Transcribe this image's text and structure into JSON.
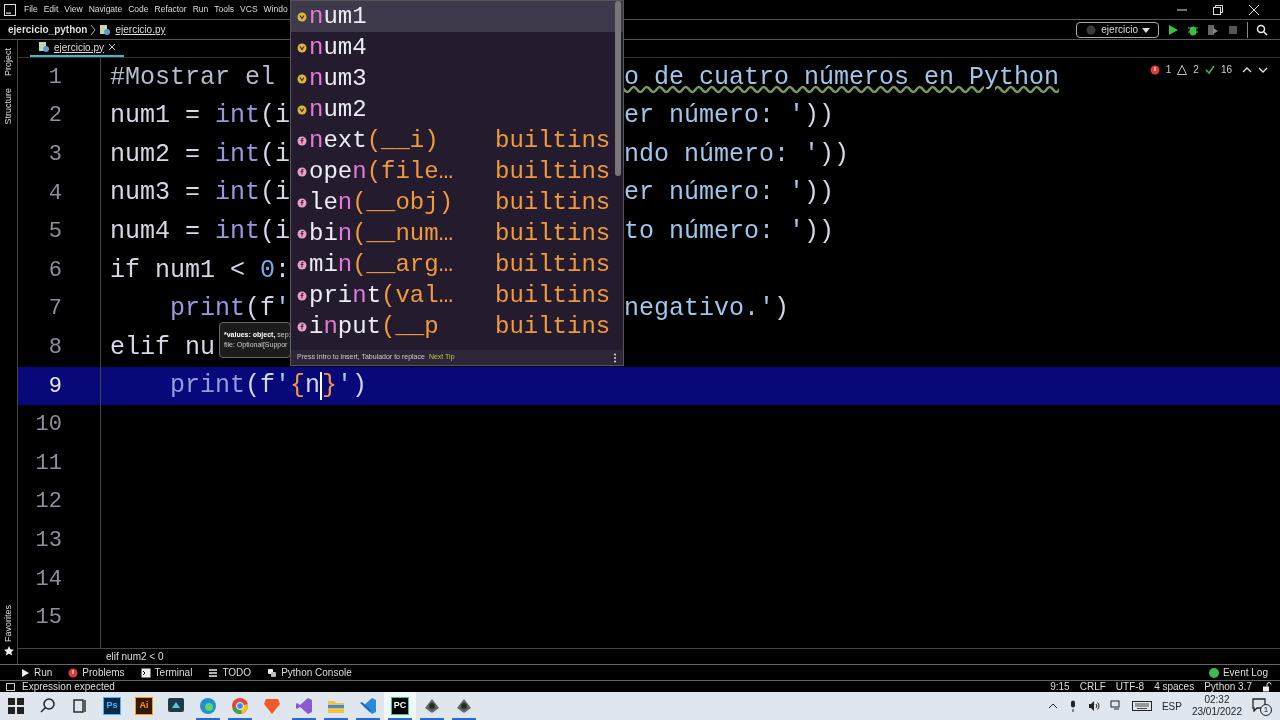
{
  "menu": [
    "File",
    "Edit",
    "View",
    "Navigate",
    "Code",
    "Refactor",
    "Run",
    "Tools",
    "VCS",
    "Windo"
  ],
  "breadcrumb": {
    "project": "ejercicio_python",
    "file": "ejercicio.py"
  },
  "run_config": "ejercicio",
  "tabs": [
    {
      "label": "ejercicio.py",
      "selected": true
    }
  ],
  "side_tools": [
    "Project",
    "Structure"
  ],
  "side_tools_bottom": [
    "Favorites"
  ],
  "inspections": [
    {
      "kind": "error",
      "count": "1"
    },
    {
      "kind": "warning",
      "count": "2"
    },
    {
      "kind": "ok",
      "count": "16"
    }
  ],
  "lines": [
    {
      "number": "1",
      "current": false,
      "indented": false,
      "left": [
        {
          "kind": "comment",
          "text": "#Mostrar el"
        }
      ],
      "right": [
        {
          "kind": "comment_typo",
          "text": "o de cuatro números en Python"
        }
      ]
    },
    {
      "number": "2",
      "current": false,
      "indented": false,
      "left": [
        {
          "kind": "plain",
          "text": "num1 = "
        },
        {
          "kind": "builtin",
          "text": "int"
        },
        {
          "kind": "plain",
          "text": "(i"
        }
      ],
      "right": [
        {
          "kind": "string",
          "text": "er número: '"
        },
        {
          "kind": "plain",
          "text": "))"
        }
      ]
    },
    {
      "number": "3",
      "current": false,
      "indented": false,
      "left": [
        {
          "kind": "plain",
          "text": "num2 = "
        },
        {
          "kind": "builtin",
          "text": "int"
        },
        {
          "kind": "plain",
          "text": "(i"
        }
      ],
      "right": [
        {
          "kind": "string",
          "text": "ndo número: '"
        },
        {
          "kind": "plain",
          "text": "))"
        }
      ]
    },
    {
      "number": "4",
      "current": false,
      "indented": false,
      "left": [
        {
          "kind": "plain",
          "text": "num3 = "
        },
        {
          "kind": "builtin",
          "text": "int"
        },
        {
          "kind": "plain",
          "text": "(i"
        }
      ],
      "right": [
        {
          "kind": "string",
          "text": "er número: '"
        },
        {
          "kind": "plain",
          "text": "))"
        }
      ]
    },
    {
      "number": "5",
      "current": false,
      "indented": false,
      "left": [
        {
          "kind": "plain",
          "text": "num4 = "
        },
        {
          "kind": "builtin",
          "text": "int"
        },
        {
          "kind": "plain",
          "text": "(i"
        }
      ],
      "right": [
        {
          "kind": "string",
          "text": "to número: '"
        },
        {
          "kind": "plain",
          "text": "))"
        }
      ]
    },
    {
      "number": "6",
      "current": false,
      "indented": false,
      "left": [
        {
          "kind": "keyword",
          "text": "if"
        },
        {
          "kind": "plain",
          "text": " num1 < "
        },
        {
          "kind": "number",
          "text": "0"
        },
        {
          "kind": "plain",
          "text": ":"
        }
      ]
    },
    {
      "number": "7",
      "current": false,
      "indented": true,
      "left": [
        {
          "kind": "builtin",
          "text": "print"
        },
        {
          "kind": "plain",
          "text": "(f"
        },
        {
          "kind": "string",
          "text": "'"
        }
      ],
      "right": [
        {
          "kind": "string",
          "text": "negativo.'"
        },
        {
          "kind": "plain",
          "text": ")"
        }
      ]
    },
    {
      "number": "8",
      "current": false,
      "indented": false,
      "left": [
        {
          "kind": "keyword",
          "text": "elif"
        },
        {
          "kind": "plain",
          "text": " nu"
        }
      ]
    },
    {
      "number": "9",
      "current": true,
      "indented": true,
      "left": [
        {
          "kind": "builtin",
          "text": "print"
        },
        {
          "kind": "plain",
          "text": "(f"
        },
        {
          "kind": "string",
          "text": "'"
        },
        {
          "kind": "brace",
          "text": "{"
        },
        {
          "kind": "plain",
          "text": "n"
        },
        {
          "kind": "caret"
        },
        {
          "kind": "brace",
          "text": "}"
        },
        {
          "kind": "string",
          "text": "'"
        },
        {
          "kind": "plain",
          "text": ")"
        }
      ]
    },
    {
      "number": "10",
      "current": false
    },
    {
      "number": "11",
      "current": false
    },
    {
      "number": "12",
      "current": false
    },
    {
      "number": "13",
      "current": false
    },
    {
      "number": "14",
      "current": false
    },
    {
      "number": "15",
      "current": false
    }
  ],
  "completion": {
    "items": [
      {
        "kind": "variable",
        "selected": true,
        "match": "n",
        "post": "um1"
      },
      {
        "kind": "variable",
        "selected": false,
        "match": "n",
        "post": "um4"
      },
      {
        "kind": "variable",
        "selected": false,
        "match": "n",
        "post": "um3"
      },
      {
        "kind": "variable",
        "selected": false,
        "match": "n",
        "post": "um2"
      },
      {
        "kind": "function",
        "selected": false,
        "match": "n",
        "post": "ext",
        "args": "(__i)",
        "source": "builtins"
      },
      {
        "kind": "function",
        "selected": false,
        "pre": "ope",
        "match": "n",
        "args": "(file…",
        "source": "builtins"
      },
      {
        "kind": "function",
        "selected": false,
        "pre": "le",
        "match": "n",
        "args": "(__obj)",
        "source": "builtins"
      },
      {
        "kind": "function",
        "selected": false,
        "pre": "bi",
        "match": "n",
        "args": "(__num…",
        "source": "builtins"
      },
      {
        "kind": "function",
        "selected": false,
        "pre": "mi",
        "match": "n",
        "args": "(__arg…",
        "source": "builtins"
      },
      {
        "kind": "function",
        "selected": false,
        "pre": "pri",
        "match": "n",
        "post": "t",
        "args": "(val…",
        "source": "builtins"
      },
      {
        "kind": "function",
        "selected": false,
        "pre": "i",
        "match": "n",
        "post": "put",
        "args": "(__p",
        "source": "builtins"
      }
    ],
    "hint": "Press Intro to insert, Tabulador to replace",
    "tip_link": "Next Tip"
  },
  "tooltip": {
    "param": "*values: object,",
    "rest": "sep:",
    "line2": "file: Optional[Suppor"
  },
  "code_breadcrumb": "elif num2 < 0",
  "tool_windows": [
    {
      "kind": "run",
      "label": "Run"
    },
    {
      "kind": "problems",
      "label": "Problems"
    },
    {
      "kind": "terminal",
      "label": "Terminal"
    },
    {
      "kind": "todo",
      "label": "TODO"
    },
    {
      "kind": "console",
      "label": "Python Console"
    }
  ],
  "event_log": "Event Log",
  "status_message": "Expression expected",
  "status_items": [
    "9:15",
    "CRLF",
    "UTF-8",
    "4 spaces",
    "Python 3.7"
  ],
  "taskbar": {
    "apps": [
      {
        "kind": "start",
        "running": false,
        "selected": false
      },
      {
        "kind": "search",
        "running": false,
        "selected": false
      },
      {
        "kind": "taskview",
        "running": false,
        "selected": false
      },
      {
        "kind": "ps",
        "label": "Ps",
        "running": false,
        "selected": false
      },
      {
        "kind": "ai",
        "label": "Ai",
        "running": false,
        "selected": false
      },
      {
        "kind": "monitor",
        "running": false,
        "selected": false
      },
      {
        "kind": "edge",
        "running": true,
        "selected": false
      },
      {
        "kind": "chrome",
        "running": true,
        "selected": false
      },
      {
        "kind": "brave",
        "running": false,
        "selected": false
      },
      {
        "kind": "vs",
        "running": true,
        "selected": false
      },
      {
        "kind": "folder",
        "running": true,
        "selected": false
      },
      {
        "kind": "vscode",
        "running": true,
        "selected": false
      },
      {
        "kind": "pycharm",
        "label": "PC",
        "running": true,
        "selected": true
      },
      {
        "kind": "game",
        "running": true,
        "selected": false
      },
      {
        "kind": "game",
        "running": true,
        "selected": false
      }
    ],
    "lang": "ESP",
    "time": "02:32",
    "date": "23/01/2022",
    "notifications": "1"
  }
}
